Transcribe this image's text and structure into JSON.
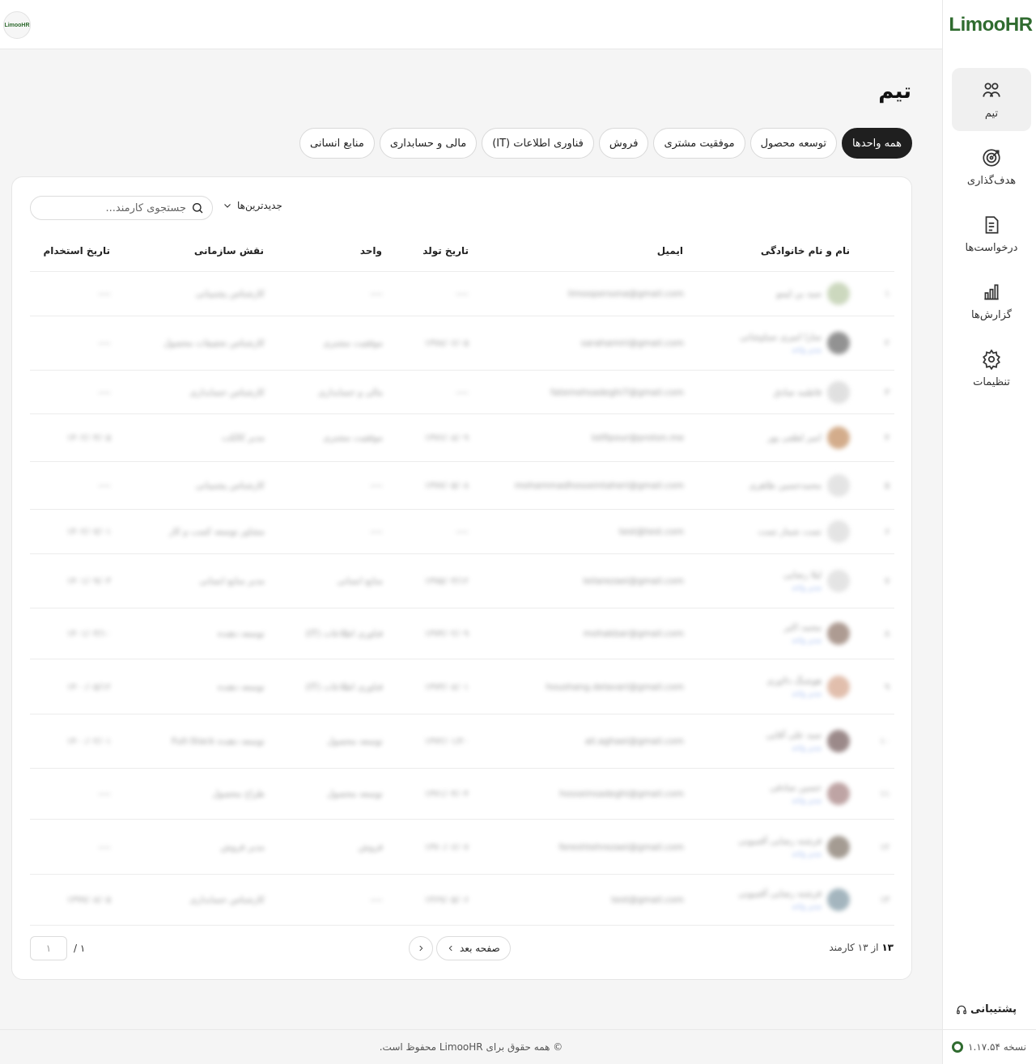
{
  "brand": {
    "logo_text": "LimooHR",
    "small_logo_text": "LimooHR",
    "accent": "#2f6b2f"
  },
  "sidebar": {
    "items": [
      {
        "label": "تیم",
        "icon": "team-icon",
        "active": true
      },
      {
        "label": "هدف‌گذاری",
        "icon": "target-icon"
      },
      {
        "label": "درخواست‌ها",
        "icon": "document-icon"
      },
      {
        "label": "گزارش‌ها",
        "icon": "chart-icon"
      },
      {
        "label": "تنظیمات",
        "icon": "gear-icon"
      }
    ],
    "support_label": "پشتیبانی",
    "version_label": "نسخه ۱.۱۷.۵۴"
  },
  "page": {
    "title": "تیم"
  },
  "tabs": [
    "همه واحدها",
    "توسعه محصول",
    "موفقیت مشتری",
    "فروش",
    "فناوری اطلاعات (IT)",
    "مالی و حسابداری",
    "منابع انسانی"
  ],
  "toolbar": {
    "search_placeholder": "جستجوی کارمند...",
    "sort_label": "جدیدترین‌ها"
  },
  "table": {
    "headers": {
      "name": "نام و نام خانوادگی",
      "email": "ایمیل",
      "birth": "تاریخ تولد",
      "unit": "واحد",
      "role": "نقش سازمانی",
      "hire": "تاریخ استخدام"
    },
    "rows": [
      {
        "idx": "۱",
        "name": "سید بن لیمو",
        "sub": "",
        "email": "limoopersona@gmail.com",
        "birth": "----",
        "unit": "----",
        "role": "کارشناس پشتیبانی",
        "hire": "----"
      },
      {
        "idx": "۲",
        "name": "سارا امیری سیاوشانی",
        "sub": "مدیر واحد",
        "email": "sarahamiri@gmail.com",
        "birth": "۱۳۷۸/۰۶/۰۵",
        "unit": "موفقیت مشتری",
        "role": "کارشناس تحقیقات محصول",
        "hire": "----"
      },
      {
        "idx": "۳",
        "name": "فاطمه صادق",
        "sub": "",
        "email": "fatemehsadeghi7@gmail.com",
        "birth": "----",
        "unit": "مالی و حسابداری",
        "role": "کارشناس حسابداری",
        "hire": "----"
      },
      {
        "idx": "۴",
        "name": "امیر لطفی پور",
        "sub": "",
        "email": "lotfipour@proton.me",
        "birth": "۱۳۷۶/۰۸/۰۹",
        "unit": "موفقیت مشتری",
        "role": "مدیر کالکت",
        "hire": "۱۴۰۲/۰۴/۰۵"
      },
      {
        "idx": "۵",
        "name": "محمدحسین طاهری",
        "sub": "",
        "email": "mohammadhosseintaheri@gmail.com",
        "birth": "۱۳۷۷/۰۵/۰۸",
        "unit": "----",
        "role": "کارشناس پشتیبانی",
        "hire": "----"
      },
      {
        "idx": "۶",
        "name": "تست شمار تست",
        "sub": "",
        "email": "test@test.com",
        "birth": "----",
        "unit": "----",
        "role": "مشاور توسعه کسب و کار",
        "hire": "۱۴۰۲/۰۷/۰۱"
      },
      {
        "idx": "۷",
        "name": "لیلا رضایی",
        "sub": "مدیر واحد",
        "email": "leilarezaei@gmail.com",
        "birth": "۱۳۷۵/۰۳/۱۲",
        "unit": "منابع انسانی",
        "role": "مدیر منابع انسانی",
        "hire": "۱۴۰۱/۰۹/۰۳"
      },
      {
        "idx": "۸",
        "name": "محمد اکبر",
        "sub": "مدیر واحد",
        "email": "mohakbar@gmail.com",
        "birth": "۱۳۷۴/۰۲/۰۹",
        "unit": "فناوری اطلاعات (IT)",
        "role": "توسعه دهنده",
        "hire": "۱۴۰۱/۰۳/۱۰"
      },
      {
        "idx": "۹",
        "name": "هوشنگ دلاوری",
        "sub": "مدیر واحد",
        "email": "houshang.delavari@gmail.com",
        "birth": "۱۳۷۳/۰۸/۰۱",
        "unit": "فناوری اطلاعات (IT)",
        "role": "توسعه دهنده",
        "hire": "۱۴۰۰/۰۵/۱۲"
      },
      {
        "idx": "۱۰",
        "name": "سید علی آقایی",
        "sub": "مدیر واحد",
        "email": "ali.aghaei@gmail.com",
        "birth": "۱۳۷۲/۰۱/۲۰",
        "unit": "توسعه محصول",
        "role": "توسعه دهنده Full-Stack",
        "hire": "۱۴۰۰/۰۲/۰۱"
      },
      {
        "idx": "۱۱",
        "name": "حسین صادقی",
        "sub": "مدیر واحد",
        "email": "hosseinsadeghi@gmail.com",
        "birth": "۱۳۷۱/۰۴/۰۴",
        "unit": "توسعه محصول",
        "role": "طراح محصول",
        "hire": "----"
      },
      {
        "idx": "۱۲",
        "name": "فرشته رضایی آقمیونی",
        "sub": "مدیر واحد",
        "email": "fereshtehrezaei@gmail.com",
        "birth": "۱۳۷۰/۰۶/۰۷",
        "unit": "فروش",
        "role": "مدیر فروش",
        "hire": "----"
      },
      {
        "idx": "۱۳",
        "name": "فرشته رضایی آقمیونی",
        "sub": "مدیر واحد",
        "email": "test@gmail.com",
        "birth": "۱۳۶۹/۰۵/۰۶",
        "unit": "----",
        "role": "کارشناس حسابداری",
        "hire": "۱۳۹۹/۰۸/۰۵"
      }
    ]
  },
  "pagination": {
    "count_bold": "۱۳",
    "count_rest": "از ۱۳ کارمند",
    "next_label": "صفحه بعد",
    "page_value": "۱",
    "total_label": "/ ۱"
  },
  "footer": {
    "copyright": "© همه حقوق برای LimooHR محفوظ است."
  }
}
